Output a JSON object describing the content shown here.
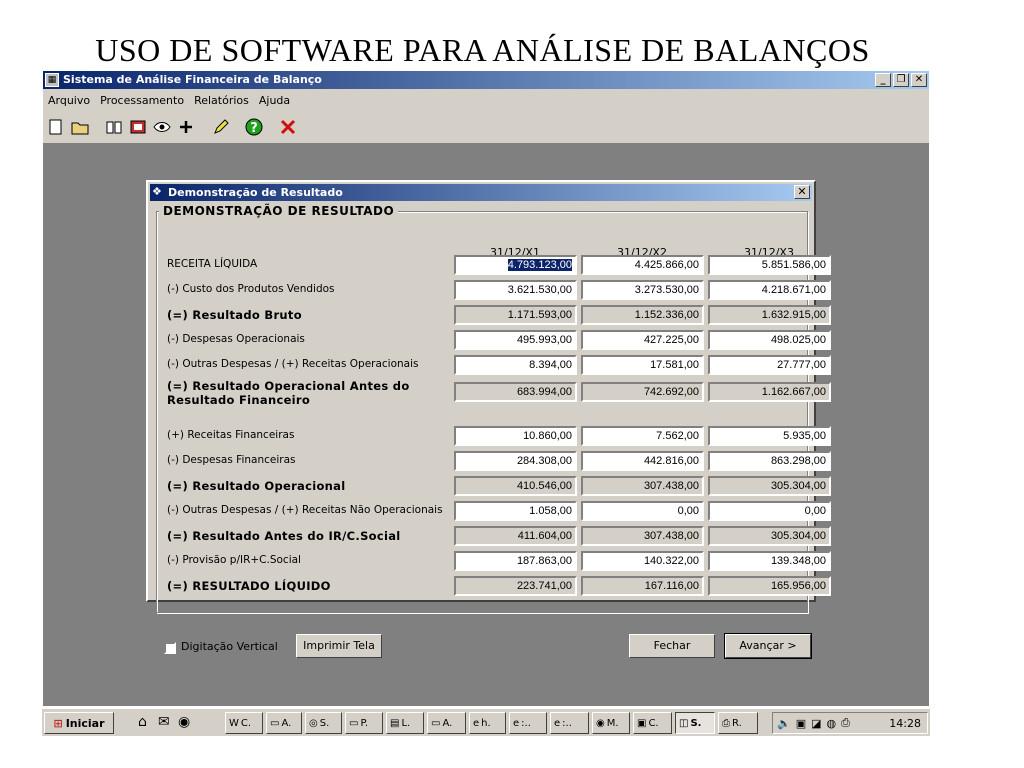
{
  "slide": {
    "title": "USO DE SOFTWARE PARA ANÁLISE DE BALANÇOS"
  },
  "app": {
    "title": "Sistema de Análise Financeira de Balanço",
    "menu": [
      "Arquivo",
      "Processamento",
      "Relatórios",
      "Ajuda"
    ],
    "toolbar_icons": [
      "new-icon",
      "open-icon",
      "book-icon",
      "stamp-icon",
      "eye-icon",
      "plus-icon",
      "pencil-icon",
      "help-icon",
      "close-red-icon"
    ]
  },
  "dialog": {
    "title": "Demonstração de Resultado",
    "group_label": "DEMONSTRAÇÃO DE RESULTADO",
    "columns": [
      "31/12/X1",
      "31/12/X2",
      "31/12/X3"
    ],
    "rows": [
      {
        "label": "RECEITA LÍQUIDA",
        "bold": false,
        "editable": true,
        "values": [
          "4.793.123,00",
          "4.425.866,00",
          "5.851.586,00"
        ]
      },
      {
        "label": "(-) Custo dos Produtos Vendidos",
        "bold": false,
        "editable": true,
        "values": [
          "3.621.530,00",
          "3.273.530,00",
          "4.218.671,00"
        ]
      },
      {
        "label": "(=) Resultado Bruto",
        "bold": true,
        "editable": false,
        "values": [
          "1.171.593,00",
          "1.152.336,00",
          "1.632.915,00"
        ]
      },
      {
        "label": "(-) Despesas Operacionais",
        "bold": false,
        "editable": true,
        "values": [
          "495.993,00",
          "427.225,00",
          "498.025,00"
        ]
      },
      {
        "label": "(-) Outras Despesas / (+) Receitas Operacionais",
        "bold": false,
        "editable": true,
        "values": [
          "8.394,00",
          "17.581,00",
          "27.777,00"
        ]
      },
      {
        "label": "(=) Resultado Operacional Antes do Resultado Financeiro",
        "bold": true,
        "editable": false,
        "values": [
          "683.994,00",
          "742.692,00",
          "1.162.667,00"
        ]
      },
      {
        "label": "(+) Receitas Financeiras",
        "bold": false,
        "editable": true,
        "values": [
          "10.860,00",
          "7.562,00",
          "5.935,00"
        ]
      },
      {
        "label": "(-) Despesas Financeiras",
        "bold": false,
        "editable": true,
        "values": [
          "284.308,00",
          "442.816,00",
          "863.298,00"
        ]
      },
      {
        "label": "(=) Resultado Operacional",
        "bold": true,
        "editable": false,
        "values": [
          "410.546,00",
          "307.438,00",
          "305.304,00"
        ]
      },
      {
        "label": "(-) Outras Despesas / (+) Receitas Não Operacionais",
        "bold": false,
        "editable": true,
        "values": [
          "1.058,00",
          "0,00",
          "0,00"
        ]
      },
      {
        "label": "(=) Resultado Antes do IR/C.Social",
        "bold": true,
        "editable": false,
        "values": [
          "411.604,00",
          "307.438,00",
          "305.304,00"
        ]
      },
      {
        "label": "(-) Provisão p/IR+C.Social",
        "bold": false,
        "editable": true,
        "values": [
          "187.863,00",
          "140.322,00",
          "139.348,00"
        ]
      },
      {
        "label": "(=) RESULTADO LÍQUIDO",
        "bold": true,
        "editable": false,
        "values": [
          "223.741,00",
          "167.116,00",
          "165.956,00"
        ]
      }
    ],
    "checkbox_label": "Digitação Vertical",
    "print_label": "Imprimir Tela",
    "close_label": "Fechar",
    "next_label": "Avançar >"
  },
  "taskbar": {
    "start_label": "Iniciar",
    "items": [
      {
        "label": "C.",
        "icon": "word-icon"
      },
      {
        "label": "A.",
        "icon": "folder-icon"
      },
      {
        "label": "S.",
        "icon": "app-icon"
      },
      {
        "label": "P.",
        "icon": "folder-icon"
      },
      {
        "label": "L.",
        "icon": "doc-icon"
      },
      {
        "label": "A.",
        "icon": "folder-icon"
      },
      {
        "label": "h.",
        "icon": "ie-icon"
      },
      {
        "label": ":..",
        "icon": "ie-icon"
      },
      {
        "label": ":..",
        "icon": "ie-icon"
      },
      {
        "label": "M.",
        "icon": "media-icon"
      },
      {
        "label": "C.",
        "icon": "monitor-icon"
      },
      {
        "label": "S.",
        "icon": "chart-icon"
      },
      {
        "label": "R.",
        "icon": "printer-icon"
      }
    ],
    "clock": "14:28"
  }
}
